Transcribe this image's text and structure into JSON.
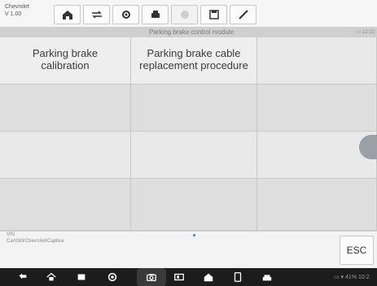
{
  "toolbar": {
    "brand": "Chevrolet",
    "version": "V 1.00",
    "icons": [
      "home-icon",
      "vehicle-swap-icon",
      "settings-icon",
      "print-icon",
      "help-icon",
      "save-icon",
      "pen-icon"
    ]
  },
  "module_bar": {
    "title": "Parking brake control module",
    "status": "12:22"
  },
  "grid": {
    "cells": [
      {
        "label": "Parking brake\ncalibration"
      },
      {
        "label": "Parking brake cable\nreplacement procedure"
      },
      {
        "label": ""
      }
    ]
  },
  "footer": {
    "vin_label": "VIN",
    "vehicle_path": "Car/GM/Chevrolet/Captiva",
    "esc_label": "ESC"
  },
  "navbar": {
    "status_text": "41% 10:2"
  },
  "colors": {
    "accent_blue": "#4a78c2",
    "nav_bg": "#1c1c1c"
  }
}
